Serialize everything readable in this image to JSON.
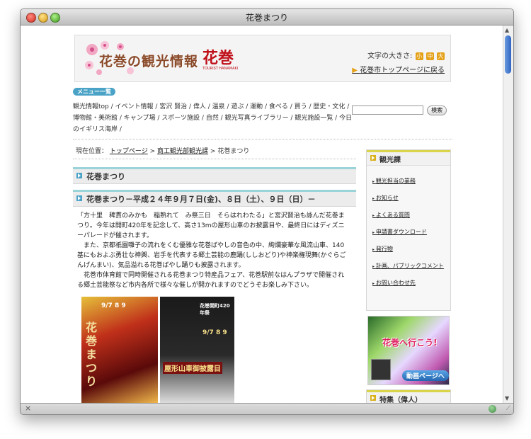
{
  "window": {
    "title": "花巻まつり"
  },
  "header": {
    "logo_text": "花巻の観光情報",
    "logo_script": "花巻",
    "logo_sub": "TOURIST HANAMAKI",
    "font_size_label": "文字の大きさ:",
    "font_sizes": [
      "小",
      "中",
      "大"
    ],
    "top_link": "花巻市トップページに戻る"
  },
  "menu": {
    "pill_label": "メニュー一覧",
    "links_text": "観光情報top / イベント情報 / 宮沢 賢治 / 偉人 / 温泉 / 遊ぶ / 運動 / 食べる / 買う / 歴史・文化 / 博物館・美術館 / キャンプ場 / スポーツ施設 / 自然 / 観光写真ライブラリー / 観光施設一覧 / 今日のイギリス海岸 /",
    "search_button": "検索"
  },
  "breadcrumb": {
    "label": "現在位置：",
    "items": [
      "トップページ",
      "商工観光部観光課",
      "花巻まつり"
    ],
    "sep": ">"
  },
  "content": {
    "heading": "花巻まつり",
    "subheading": "花巻まつり－平成２４年９月７日(金)、８日（土）、９日（日）－",
    "paragraphs": [
      "「方十里　稗貫のみかも　稲熟れて　み祭三日　そらはれわたる」と宮沢賢治も詠んだ花巻まつり。今年は開町420年を記念して、高さ13mの屋形山車のお披露目や、最終日にはディズニーパレードが催されます。",
      "　また、京都祇園囃子の流れをくむ優雅な花巻ばやしの音色の中、絢爛豪華な風流山車、140基にもおよぶ勇壮な神輿、岩手を代表する郷土芸能の鹿踊(ししおどり)や神楽権現舞(かぐらごんげんまい)、気品溢れる花巻ばやし踊りも披露されます。",
      "　花巻市体育館で同時開催される花巻まつり特産品フェア、花巻駅前なはんプラザで開催される郷土芸能祭など市内各所で様々な催しが開かれますのでどうぞお楽しみ下さい。"
    ],
    "poster1_text": "花巻まつり",
    "poster1_dates": "9/7 8 9",
    "poster2_text": "屋形山車御披露目",
    "poster2_dates": "9/7 8 9",
    "poster2_badge": "花巻開町420年祭"
  },
  "sidebar": {
    "box1_title": "観光課",
    "box1_items": [
      "観光担当の業務",
      "お知らせ",
      "よくある質問",
      "申請書ダウンロード",
      "発行物",
      "計画、パブリックコメント",
      "お問い合わせ先"
    ],
    "banner_title": "花巻へ行こう!",
    "banner_button": "動画ページへ",
    "box2_title": "特集（偉人）"
  }
}
